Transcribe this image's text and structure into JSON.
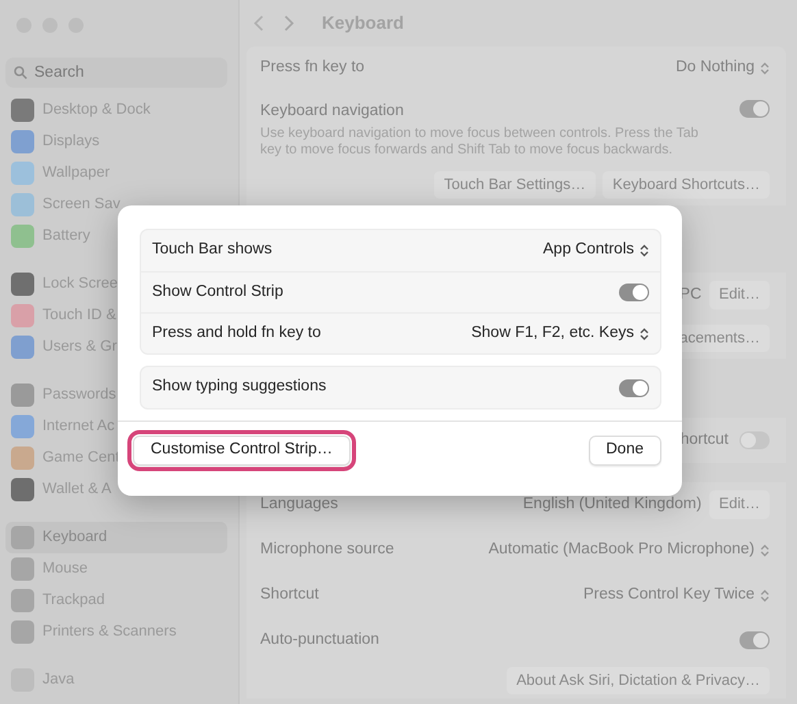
{
  "window": {
    "title": "Keyboard"
  },
  "sidebar": {
    "search": {
      "placeholder": "Search"
    },
    "groups": [
      [
        {
          "label": "Desktop & Dock",
          "selected": false,
          "color": "#7a7a7a"
        },
        {
          "label": "Displays",
          "selected": false,
          "color": "#7fa0d0"
        },
        {
          "label": "Wallpaper",
          "selected": false,
          "color": "#9cc0dc"
        },
        {
          "label": "Screen Sav",
          "selected": false,
          "color": "#9cbfd8"
        },
        {
          "label": "Battery",
          "selected": false,
          "color": "#8fc08f"
        }
      ],
      [
        {
          "label": "Lock Scree",
          "selected": false,
          "color": "#6f6f6f"
        },
        {
          "label": "Touch ID &",
          "selected": false,
          "color": "#d9a0a8"
        },
        {
          "label": "Users & Gr",
          "selected": false,
          "color": "#7f9fcf"
        }
      ],
      [
        {
          "label": "Passwords",
          "selected": false,
          "color": "#9a9a9a"
        },
        {
          "label": "Internet Ac",
          "selected": false,
          "color": "#85a8d8"
        },
        {
          "label": "Game Cent",
          "selected": false,
          "color": "#c9a98e"
        },
        {
          "label": "Wallet & A",
          "selected": false,
          "color": "#6e6e6e"
        }
      ],
      [
        {
          "label": "Keyboard",
          "selected": true,
          "color": "#a6a6a6"
        },
        {
          "label": "Mouse",
          "selected": false,
          "color": "#a6a6a6"
        },
        {
          "label": "Trackpad",
          "selected": false,
          "color": "#a6a6a6"
        },
        {
          "label": "Printers & Scanners",
          "selected": false,
          "color": "#a6a6a6"
        }
      ],
      [
        {
          "label": "Java",
          "selected": false,
          "color": "#bdbdbd"
        }
      ]
    ]
  },
  "settings": [
    {
      "kind": "select",
      "label": "Press fn key to",
      "value": "Do Nothing"
    },
    {
      "kind": "toggle",
      "label": "Keyboard navigation",
      "description": "Use keyboard navigation to move focus between controls. Press the Tab key to move focus forwards and Shift Tab to move focus backwards.",
      "on": true
    },
    {
      "kind": "buttons",
      "buttons": [
        "Touch Bar Settings…",
        "Keyboard Shortcuts…"
      ]
    },
    {
      "kind": "value-button",
      "value": "PC",
      "button": "Edit…"
    },
    {
      "kind": "buttons",
      "buttons": [
        "acements…"
      ]
    },
    {
      "kind": "tail-toggle",
      "label": "hortcut",
      "on": false
    },
    {
      "kind": "value-button",
      "label": "Languages",
      "value": "English (United Kingdom)",
      "button": "Edit…"
    },
    {
      "kind": "select",
      "label": "Microphone source",
      "value": "Automatic (MacBook Pro Microphone)"
    },
    {
      "kind": "select",
      "label": "Shortcut",
      "value": "Press Control Key Twice"
    },
    {
      "kind": "toggle",
      "label": "Auto-punctuation",
      "on": true
    },
    {
      "kind": "buttons",
      "buttons": [
        "About Ask Siri, Dictation & Privacy…"
      ]
    }
  ],
  "sheet": {
    "groups": [
      [
        {
          "kind": "select",
          "label": "Touch Bar shows",
          "value": "App Controls"
        },
        {
          "kind": "toggle",
          "label": "Show Control Strip",
          "on": true
        },
        {
          "kind": "select",
          "label": "Press and hold fn key to",
          "value": "Show F1, F2, etc. Keys"
        }
      ],
      [
        {
          "kind": "toggle",
          "label": "Show typing suggestions",
          "on": true
        }
      ]
    ],
    "buttons": [
      {
        "label": "Customise Control Strip…",
        "highlighted": true
      },
      {
        "label": "Done",
        "highlighted": false
      }
    ]
  }
}
